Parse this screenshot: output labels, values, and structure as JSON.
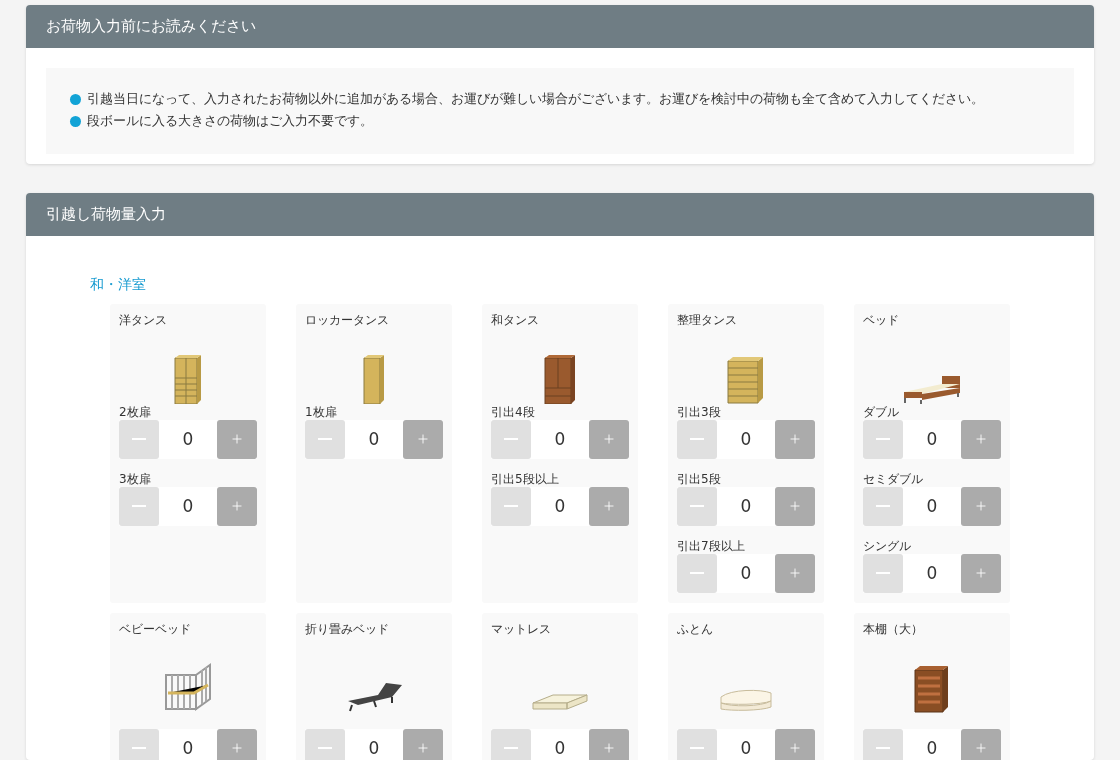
{
  "notice": {
    "title": "お荷物入力前にお読みください",
    "items": [
      "引越当日になって、入力されたお荷物以外に追加がある場合、お運びが難しい場合がございます。お運びを検討中の荷物も全て含めて入力してください。",
      "段ボールに入る大きさの荷物はご入力不要です。"
    ]
  },
  "inventory": {
    "title": "引越し荷物量入力",
    "sections": [
      {
        "label": "和・洋室",
        "items": [
          {
            "name": "洋タンス",
            "options": [
              {
                "label": "2枚扉",
                "value": "0",
                "decrement_disabled": true
              },
              {
                "label": "3枚扉",
                "value": "0",
                "decrement_disabled": true
              }
            ]
          },
          {
            "name": "ロッカータンス",
            "options": [
              {
                "label": "1枚扉",
                "value": "0",
                "decrement_disabled": true
              }
            ]
          },
          {
            "name": "和タンス",
            "options": [
              {
                "label": "引出4段",
                "value": "0",
                "decrement_disabled": true
              },
              {
                "label": "引出5段以上",
                "value": "0",
                "decrement_disabled": true
              }
            ]
          },
          {
            "name": "整理タンス",
            "options": [
              {
                "label": "引出3段",
                "value": "0",
                "decrement_disabled": true
              },
              {
                "label": "引出5段",
                "value": "0",
                "decrement_disabled": true
              },
              {
                "label": "引出7段以上",
                "value": "0",
                "decrement_disabled": true
              }
            ]
          },
          {
            "name": "ベッド",
            "options": [
              {
                "label": "ダブル",
                "value": "0",
                "decrement_disabled": true
              },
              {
                "label": "セミダブル",
                "value": "0",
                "decrement_disabled": true
              },
              {
                "label": "シングル",
                "value": "0",
                "decrement_disabled": true
              }
            ]
          },
          {
            "name": "ベビーベッド",
            "options": [
              {
                "value": "0",
                "decrement_disabled": true
              }
            ]
          },
          {
            "name": "折り畳みベッド",
            "options": [
              {
                "value": "0",
                "decrement_disabled": true
              }
            ]
          },
          {
            "name": "マットレス",
            "options": [
              {
                "value": "0",
                "decrement_disabled": true
              }
            ]
          },
          {
            "name": "ふとん",
            "options": [
              {
                "value": "0",
                "decrement_disabled": true
              }
            ]
          },
          {
            "name": "本棚（大）",
            "options": [
              {
                "value": "0",
                "decrement_disabled": true
              }
            ]
          }
        ]
      }
    ]
  }
}
